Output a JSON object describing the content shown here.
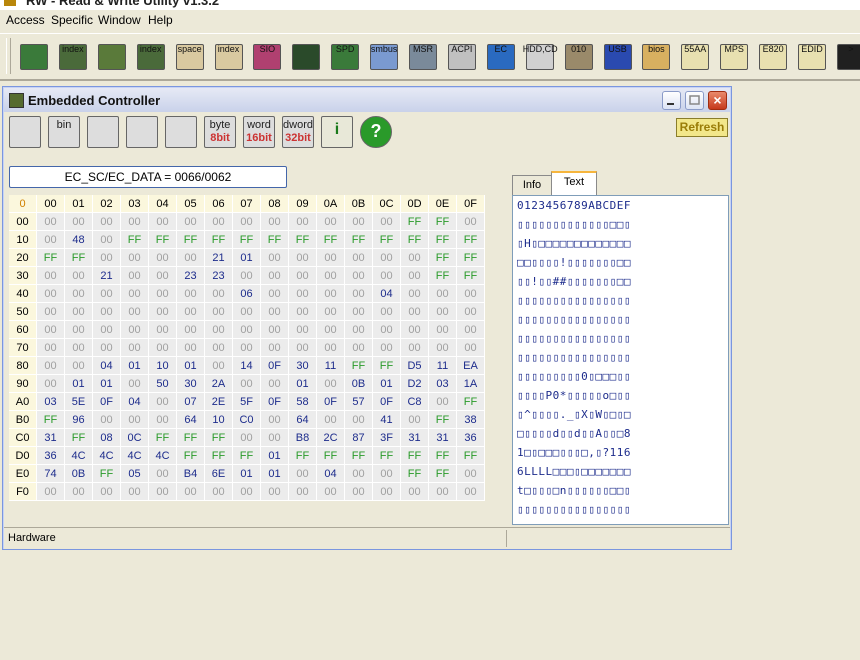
{
  "app": {
    "title": "RW - Read & Write Utility v1.3.2"
  },
  "menu": [
    "Access",
    "Specific",
    "Window",
    "Help"
  ],
  "toolbar": [
    {
      "icon": "pci-icon",
      "label": ""
    },
    {
      "icon": "pci-index-icon",
      "label": "index"
    },
    {
      "icon": "memory-icon",
      "label": ""
    },
    {
      "icon": "memory-index-icon",
      "label": "index"
    },
    {
      "icon": "io-space-icon",
      "label": "space"
    },
    {
      "icon": "io-index-icon",
      "label": "index"
    },
    {
      "icon": "sio-icon",
      "label": "SIO"
    },
    {
      "icon": "oscilloscope-icon",
      "label": ""
    },
    {
      "icon": "spd-icon",
      "label": "SPD"
    },
    {
      "icon": "smbus-icon",
      "label": "smbus"
    },
    {
      "icon": "msr-icon",
      "label": "MSR"
    },
    {
      "icon": "acpi-icon",
      "label": "ACPI"
    },
    {
      "icon": "ec-icon",
      "label": "EC"
    },
    {
      "icon": "hdd-cd-icon",
      "label": "HDD,CD"
    },
    {
      "icon": "hdd-010-icon",
      "label": "010"
    },
    {
      "icon": "usb-icon",
      "label": "USB"
    },
    {
      "icon": "smbios-icon",
      "label": "bios"
    },
    {
      "icon": "55aa-icon",
      "label": "55AA"
    },
    {
      "icon": "mps-icon",
      "label": "MPS"
    },
    {
      "icon": "e820-icon",
      "label": "E820"
    },
    {
      "icon": "edid-icon",
      "label": "EDID"
    },
    {
      "icon": "command-icon",
      "label": ">"
    }
  ],
  "window": {
    "title": "Embedded Controller",
    "refresh_label": "Refresh",
    "address": "EC_SC/EC_DATA = 0066/0062",
    "toolbar": [
      {
        "name": "save-button",
        "t1": "",
        "t2": ""
      },
      {
        "name": "save-bin-button",
        "t1": "bin",
        "t2": ""
      },
      {
        "name": "load-button",
        "t1": "",
        "t2": ""
      },
      {
        "name": "find-button",
        "t1": "",
        "t2": ""
      },
      {
        "name": "compare-button",
        "t1": "",
        "t2": ""
      },
      {
        "name": "byte-button",
        "t1": "byte",
        "t2": "8bit"
      },
      {
        "name": "word-button",
        "t1": "word",
        "t2": "16bit"
      },
      {
        "name": "dword-button",
        "t1": "dword",
        "t2": "32bit"
      },
      {
        "name": "info-button",
        "t1": "i",
        "t2": ""
      },
      {
        "name": "help-button",
        "t1": "?",
        "t2": ""
      }
    ],
    "corner": "0",
    "col_headers": [
      "00",
      "01",
      "02",
      "03",
      "04",
      "05",
      "06",
      "07",
      "08",
      "09",
      "0A",
      "0B",
      "0C",
      "0D",
      "0E",
      "0F"
    ],
    "rows": [
      {
        "addr": "00",
        "cells": [
          "00",
          "00",
          "00",
          "00",
          "00",
          "00",
          "00",
          "00",
          "00",
          "00",
          "00",
          "00",
          "00",
          "FF",
          "FF",
          "00"
        ]
      },
      {
        "addr": "10",
        "cells": [
          "00",
          "48",
          "00",
          "FF",
          "FF",
          "FF",
          "FF",
          "FF",
          "FF",
          "FF",
          "FF",
          "FF",
          "FF",
          "FF",
          "FF",
          "FF"
        ]
      },
      {
        "addr": "20",
        "cells": [
          "FF",
          "FF",
          "00",
          "00",
          "00",
          "00",
          "21",
          "01",
          "00",
          "00",
          "00",
          "00",
          "00",
          "00",
          "FF",
          "FF"
        ]
      },
      {
        "addr": "30",
        "cells": [
          "00",
          "00",
          "21",
          "00",
          "00",
          "23",
          "23",
          "00",
          "00",
          "00",
          "00",
          "00",
          "00",
          "00",
          "FF",
          "FF"
        ]
      },
      {
        "addr": "40",
        "cells": [
          "00",
          "00",
          "00",
          "00",
          "00",
          "00",
          "00",
          "06",
          "00",
          "00",
          "00",
          "00",
          "04",
          "00",
          "00",
          "00"
        ]
      },
      {
        "addr": "50",
        "cells": [
          "00",
          "00",
          "00",
          "00",
          "00",
          "00",
          "00",
          "00",
          "00",
          "00",
          "00",
          "00",
          "00",
          "00",
          "00",
          "00"
        ]
      },
      {
        "addr": "60",
        "cells": [
          "00",
          "00",
          "00",
          "00",
          "00",
          "00",
          "00",
          "00",
          "00",
          "00",
          "00",
          "00",
          "00",
          "00",
          "00",
          "00"
        ]
      },
      {
        "addr": "70",
        "cells": [
          "00",
          "00",
          "00",
          "00",
          "00",
          "00",
          "00",
          "00",
          "00",
          "00",
          "00",
          "00",
          "00",
          "00",
          "00",
          "00"
        ]
      },
      {
        "addr": "80",
        "cells": [
          "00",
          "00",
          "04",
          "01",
          "10",
          "01",
          "00",
          "14",
          "0F",
          "30",
          "11",
          "FF",
          "FF",
          "D5",
          "11",
          "EA"
        ]
      },
      {
        "addr": "90",
        "cells": [
          "00",
          "01",
          "01",
          "00",
          "50",
          "30",
          "2A",
          "00",
          "00",
          "01",
          "00",
          "0B",
          "01",
          "D2",
          "03",
          "1A"
        ]
      },
      {
        "addr": "A0",
        "cells": [
          "03",
          "5E",
          "0F",
          "04",
          "00",
          "07",
          "2E",
          "5F",
          "0F",
          "58",
          "0F",
          "57",
          "0F",
          "C8",
          "00",
          "FF"
        ]
      },
      {
        "addr": "B0",
        "cells": [
          "FF",
          "96",
          "00",
          "00",
          "00",
          "64",
          "10",
          "C0",
          "00",
          "64",
          "00",
          "00",
          "41",
          "00",
          "FF",
          "38"
        ]
      },
      {
        "addr": "C0",
        "cells": [
          "31",
          "FF",
          "08",
          "0C",
          "FF",
          "FF",
          "FF",
          "00",
          "00",
          "B8",
          "2C",
          "87",
          "3F",
          "31",
          "31",
          "36"
        ]
      },
      {
        "addr": "D0",
        "cells": [
          "36",
          "4C",
          "4C",
          "4C",
          "4C",
          "FF",
          "FF",
          "FF",
          "01",
          "FF",
          "FF",
          "FF",
          "FF",
          "FF",
          "FF",
          "FF"
        ]
      },
      {
        "addr": "E0",
        "cells": [
          "74",
          "0B",
          "FF",
          "05",
          "00",
          "B4",
          "6E",
          "01",
          "01",
          "00",
          "04",
          "00",
          "00",
          "FF",
          "FF",
          "00"
        ]
      },
      {
        "addr": "F0",
        "cells": [
          "00",
          "00",
          "00",
          "00",
          "00",
          "00",
          "00",
          "00",
          "00",
          "00",
          "00",
          "00",
          "00",
          "00",
          "00",
          "00"
        ]
      }
    ],
    "tabs": [
      "Info",
      "Text"
    ],
    "text_header": "0123456789ABCDEF",
    "text_rows": [
      "▯▯▯▯▯▯▯▯▯▯▯▯▯□□▯",
      "▯H▯□□□□□□□□□□□□□",
      "□□▯▯▯▯!▯▯▯▯▯▯▯□□",
      "▯▯!▯▯##▯▯▯▯▯▯▯□□",
      "▯▯▯▯▯▯▯▯▯▯▯▯▯▯▯▯",
      "▯▯▯▯▯▯▯▯▯▯▯▯▯▯▯▯",
      "▯▯▯▯▯▯▯▯▯▯▯▯▯▯▯▯",
      "▯▯▯▯▯▯▯▯▯▯▯▯▯▯▯▯",
      "▯▯▯▯▯▯▯▯▯0▯□□□▯▯",
      "▯▯▯▯P0*▯▯▯▯▯o□▯▯",
      "▯^▯▯▯▯._▯X▯W▯□▯□",
      "□▯▯▯▯d▯▯d▯▯A▯▯□8",
      "1□▯□□□▯▯▯□,▯?116",
      "6LLLL□□□▯□□□□□□□",
      "t□▯▯▯□n▯▯▯▯▯▯□□▯",
      "▯▯▯▯▯▯▯▯▯▯▯▯▯▯▯▯"
    ],
    "status": "Hardware"
  }
}
